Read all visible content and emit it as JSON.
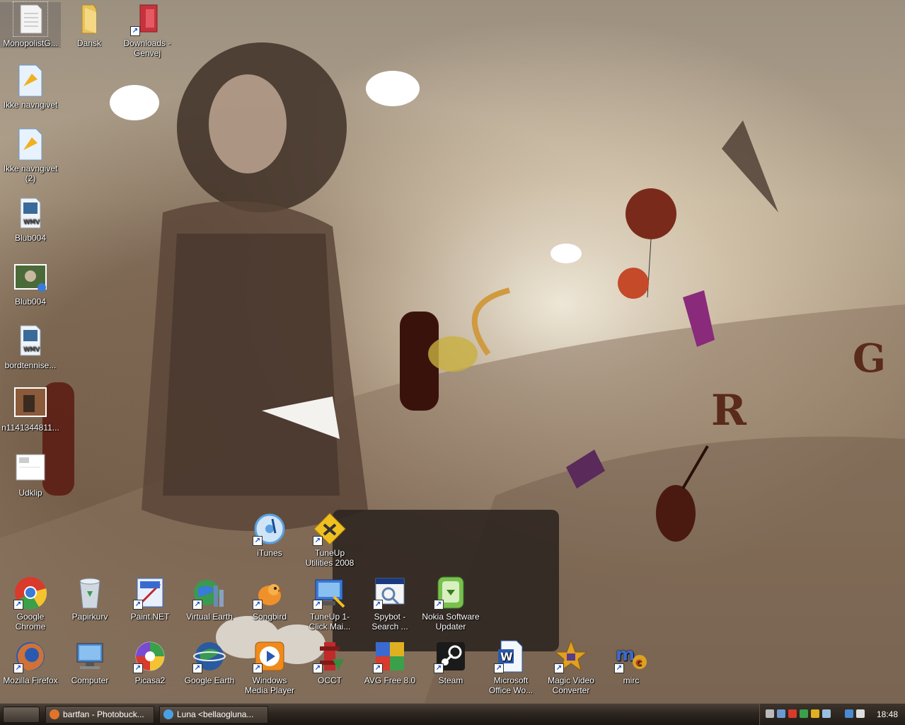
{
  "desktop": {
    "left_icons": [
      {
        "label": "MonopolistG...",
        "icon": "text-document-icon",
        "color": "#f4f4f4"
      },
      {
        "label": "Ikke navngivet",
        "icon": "image-file-icon",
        "color": "#9ec8ee"
      },
      {
        "label": "Ikke navngivet (2)",
        "icon": "image-file-icon",
        "color": "#9ec8ee"
      },
      {
        "label": "Blub004",
        "icon": "wmv-video-icon",
        "color": "#dfe8f0"
      },
      {
        "label": "Blub004",
        "icon": "photo-thumbnail-icon",
        "color": "#4a6a3a"
      },
      {
        "label": "bordtennise...",
        "icon": "wmv-video-icon",
        "color": "#dfe8f0"
      },
      {
        "label": "n1141344811...",
        "icon": "photo-thumbnail-icon",
        "color": "#8a5a3a"
      },
      {
        "label": "Udklip",
        "icon": "screenshot-icon",
        "color": "#ffffff"
      }
    ],
    "top_icons": [
      {
        "label": "Dansk",
        "icon": "folder-icon",
        "color": "#e8c35a"
      },
      {
        "label": "Downloads - Genvej",
        "icon": "downloads-folder-icon",
        "color": "#c8323c"
      }
    ],
    "middle_icons": [
      {
        "label": "iTunes",
        "icon": "itunes-icon",
        "color": "#5aa0e0"
      },
      {
        "label": "TuneUp Utilities 2008",
        "icon": "tuneup-icon",
        "color": "#f0c020"
      }
    ],
    "row1_icons": [
      {
        "label": "Google Chrome",
        "icon": "chrome-icon",
        "color": "#d93a2b"
      },
      {
        "label": "Papirkurv",
        "icon": "recycle-bin-icon",
        "color": "#cfd8e0"
      },
      {
        "label": "Paint.NET",
        "icon": "paintnet-icon",
        "color": "#3a6ad0"
      },
      {
        "label": "Virtual Earth",
        "icon": "virtual-earth-icon",
        "color": "#3a9a50"
      },
      {
        "label": "Songbird",
        "icon": "songbird-icon",
        "color": "#f0902a"
      },
      {
        "label": "TuneUp 1-Click Mai...",
        "icon": "tuneup-maintenance-icon",
        "color": "#3a7ad8"
      },
      {
        "label": "Spybot - Search ...",
        "icon": "spybot-icon",
        "color": "#5a80b0"
      },
      {
        "label": "Nokia Software Updater",
        "icon": "nokia-updater-icon",
        "color": "#7ac050"
      }
    ],
    "row2_icons": [
      {
        "label": "Mozilla Firefox",
        "icon": "firefox-icon",
        "color": "#e0742a"
      },
      {
        "label": "Computer",
        "icon": "computer-icon",
        "color": "#4a8ad0"
      },
      {
        "label": "Picasa2",
        "icon": "picasa-icon",
        "color": "#7a4ad0"
      },
      {
        "label": "Google Earth",
        "icon": "google-earth-icon",
        "color": "#2a5aa0"
      },
      {
        "label": "Windows Media Player",
        "icon": "media-player-icon",
        "color": "#f08a1a"
      },
      {
        "label": "OCCT",
        "icon": "occt-icon",
        "color": "#c02a2a"
      },
      {
        "label": "AVG Free 8.0",
        "icon": "avg-icon",
        "color": "#e0b020"
      },
      {
        "label": "Steam",
        "icon": "steam-icon",
        "color": "#1a1a1a"
      },
      {
        "label": "Microsoft Office Wo...",
        "icon": "word-icon",
        "color": "#2a5ab0"
      },
      {
        "label": "Magic Video Converter",
        "icon": "video-converter-icon",
        "color": "#e0a020"
      },
      {
        "label": "mirc",
        "icon": "mirc-icon",
        "color": "#3a6ad0"
      }
    ]
  },
  "taskbar": {
    "tasks": [
      {
        "label": "bartfan - Photobuck...",
        "icon": "firefox-icon",
        "color": "#e0742a"
      },
      {
        "label": "Luna <bellaogluna...",
        "icon": "messenger-icon",
        "color": "#4aa0e0"
      }
    ],
    "tray_icons": [
      "steam-tray-icon",
      "network-tray-icon",
      "security-tray-icon",
      "safely-remove-tray-icon",
      "antivirus-tray-icon",
      "music-tray-icon",
      "monitor-tray-icon",
      "volume-tray-icon"
    ],
    "clock": "18:48"
  }
}
